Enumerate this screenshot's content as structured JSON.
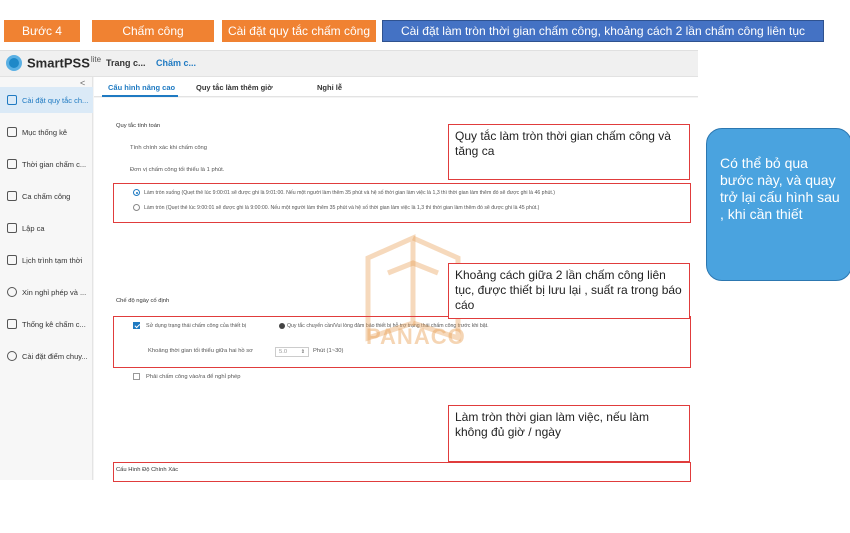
{
  "steps": {
    "step": "Bước 4",
    "attendance": "Chấm công",
    "rules": "Cài đặt quy tắc chấm công",
    "detail": "Cài đặt làm tròn thời gian chấm công, khoảng cách 2 lần chấm công liên tục"
  },
  "app": {
    "name": "SmartPSS",
    "edition": "lite",
    "breadcrumb_1": "Trang c...",
    "breadcrumb_2": "Chấm c..."
  },
  "sidebar": {
    "collapse": "<",
    "items": [
      {
        "label": "Cài đặt quy tắc ch...",
        "icon": "settings-calendar-icon",
        "active": true
      },
      {
        "label": "Mục thống kê",
        "icon": "statistics-icon"
      },
      {
        "label": "Thời gian chấm c...",
        "icon": "time-calendar-icon"
      },
      {
        "label": "Ca chấm công",
        "icon": "shift-list-icon"
      },
      {
        "label": "Lập ca",
        "icon": "schedule-icon"
      },
      {
        "label": "Lịch trình tạm thời",
        "icon": "calendar-grid-icon"
      },
      {
        "label": "Xin nghỉ phép và ...",
        "icon": "people-leave-icon"
      },
      {
        "label": "Thống kê chấm c...",
        "icon": "report-icon"
      },
      {
        "label": "Cài đặt điểm chuy...",
        "icon": "location-pin-icon"
      }
    ]
  },
  "tabs": [
    {
      "label": "Cấu hình nâng cao",
      "active": true
    },
    {
      "label": "Quy tắc làm thêm giờ"
    },
    {
      "label": "Nghỉ lễ"
    }
  ],
  "content": {
    "calc_rule_title": "Quy tắc tính toán",
    "precise_calc": "Tính chính xác khi chấm công",
    "min_unit": "Đơn vị chấm công tối thiểu là 1 phút.",
    "round_down": "Làm tròn xuống (Quẹt thẻ lúc 9:00:01 sẽ được ghi là 9:01:00. Nếu một người làm thêm 35 phút và hệ số thời gian làm việc là 1,3 thì thời gian làm thêm đó sẽ được ghi là 46 phút.)",
    "round": "Làm tròn (Quẹt thẻ lúc 9:00:01 sẽ được ghi là 9:00:00. Nếu một người làm thêm 35 phút và hệ số thời gian làm việc là 1,3 thì thời gian làm thêm đó sẽ được ghi là 45 phút.)",
    "fixed_day_mode": "Chế độ ngày cố định",
    "use_device_status": "Sử dụng trạng thái chấm công của thiết bị",
    "transfer_rule": "Quy tắc chuyển cần/Vui lòng đảm bảo thiết bị hỗ trợ trạng thái chấm công trước khi bật.",
    "min_interval_label": "Khoảng thời gian tối thiểu giữa hai hồ sơ",
    "min_interval_value": "5.0",
    "min_interval_unit": "Phút (1~30)",
    "leave_checkin": "Phải chấm công vào/ra để nghỉ phép",
    "precision_config": "Cấu Hình Độ Chính Xác"
  },
  "annotations": {
    "rounding": "Quy tắc làm tròn thời gian chấm công và tăng ca",
    "interval": "Khoảng cách giữa 2 lần chấm công liên tục, được thiết bị lưu lại , suất ra trong báo cáo",
    "workday": "Làm tròn thời gian làm việc, nếu làm không đủ giờ / ngày",
    "callout": "Có thể bỏ qua bước này, và quay trở lại cấu hình sau , khi cần thiết"
  },
  "watermark": "PANACO",
  "colors": {
    "step_orange": "#f08232",
    "step_blue": "#4472c4",
    "accent": "#1f7ac2",
    "annotation_red": "#e03c3c",
    "callout_blue": "#4aa3df"
  }
}
